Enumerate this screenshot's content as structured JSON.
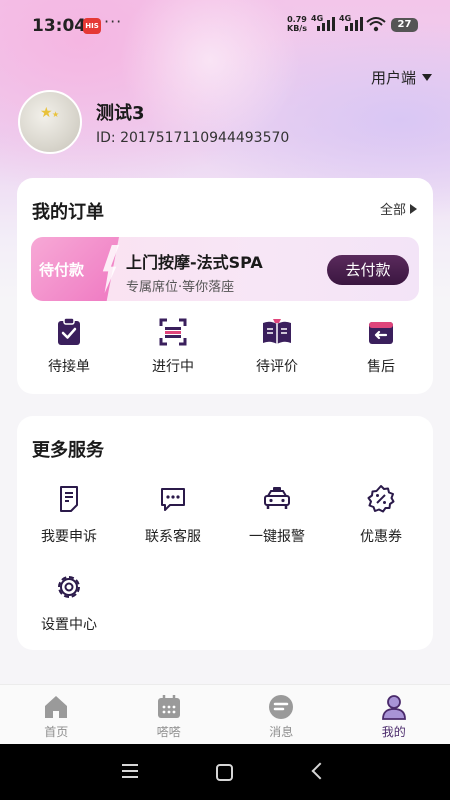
{
  "status_bar": {
    "time": "13:04",
    "notification_badge": "HIS",
    "more_dots": "···",
    "net_speed_value": "0.79",
    "net_speed_unit": "KB/s",
    "signal_1_label": "4G",
    "signal_2_label": "4G",
    "battery": "27"
  },
  "header": {
    "role_switch_label": "用户端"
  },
  "profile": {
    "name": "测试3",
    "id_text": "ID: 2017517110944493570"
  },
  "orders": {
    "title": "我的订单",
    "all_label": "全部",
    "pending": {
      "tag": "待付款",
      "service_title": "上门按摩-法式SPA",
      "subtitle": "专属席位·等你落座",
      "pay_button": "去付款"
    },
    "statuses": [
      {
        "label": "待接单",
        "icon": "clipboard-check-icon"
      },
      {
        "label": "进行中",
        "icon": "scan-progress-icon"
      },
      {
        "label": "待评价",
        "icon": "open-book-icon"
      },
      {
        "label": "售后",
        "icon": "return-box-icon"
      }
    ]
  },
  "services": {
    "title": "更多服务",
    "items": [
      {
        "label": "我要申诉",
        "icon": "complaint-doc-icon"
      },
      {
        "label": "联系客服",
        "icon": "chat-bubble-icon"
      },
      {
        "label": "一键报警",
        "icon": "police-car-icon"
      },
      {
        "label": "优惠券",
        "icon": "coupon-percent-icon"
      },
      {
        "label": "设置中心",
        "icon": "gear-icon"
      }
    ]
  },
  "bottom_nav": {
    "items": [
      {
        "label": "首页",
        "icon": "home-icon",
        "active": false
      },
      {
        "label": "嗒嗒",
        "icon": "calendar-icon",
        "active": false
      },
      {
        "label": "消息",
        "icon": "message-icon",
        "active": false
      },
      {
        "label": "我的",
        "icon": "user-icon",
        "active": true
      }
    ]
  },
  "colors": {
    "accent_dark": "#3a1640",
    "accent_purple": "#4a2a6b",
    "pending_pink": "#ef79c2",
    "nav_inactive": "#8e8e8e"
  }
}
